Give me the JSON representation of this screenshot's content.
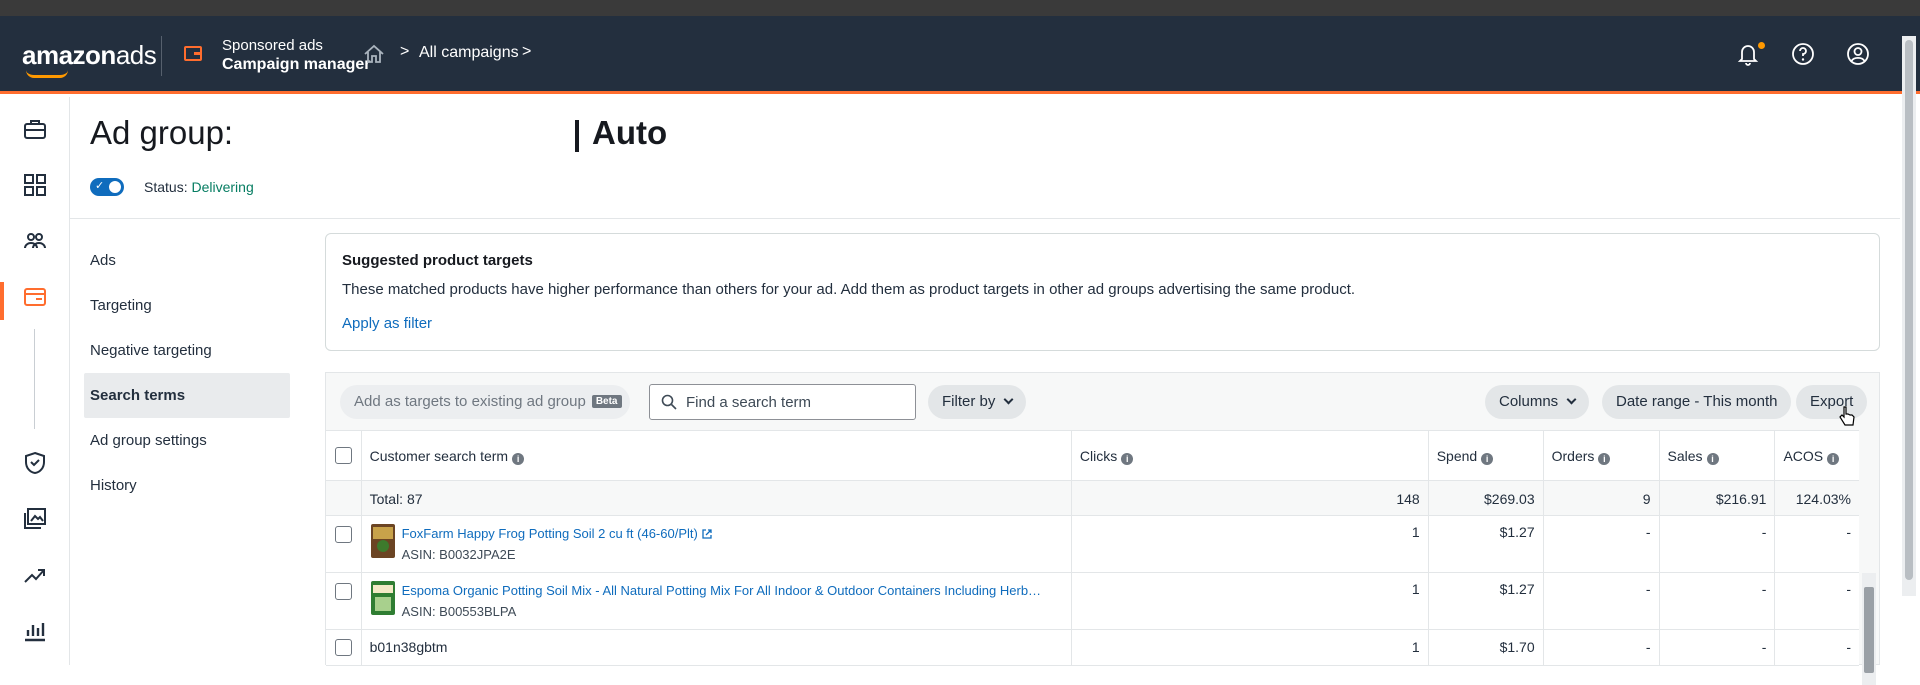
{
  "topnav": {
    "logo_main": "amazon",
    "logo_ads": "ads",
    "app_line1": "Sponsored ads",
    "app_line2": "Campaign manager",
    "breadcrumb_sep1": ">",
    "breadcrumb": "All campaigns",
    "breadcrumb_sep2": ">",
    "icons": [
      "notifications-icon",
      "help-icon",
      "account-icon"
    ]
  },
  "rail": {
    "icons": [
      "briefcase-icon",
      "dashboard-icon",
      "audience-icon",
      "campaigns-icon",
      "shield-icon",
      "media-icon",
      "trend-icon",
      "reports-icon"
    ],
    "accent": "#ff6d2e"
  },
  "header": {
    "title": "Ad group:",
    "title_suffix": "Auto",
    "status_label": "Status:",
    "status_value": "Delivering",
    "status_color": "#067d62"
  },
  "subnav": {
    "items": [
      "Ads",
      "Targeting",
      "Negative targeting",
      "Search terms",
      "Ad group settings",
      "History"
    ],
    "active": "Search terms"
  },
  "suggested": {
    "title": "Suggested product targets",
    "body": "These matched products have higher performance than others for your ad. Add them as product targets in other ad groups advertising the same product.",
    "link": "Apply as filter"
  },
  "toolbar": {
    "add_targets": "Add as targets to existing ad group",
    "beta": "Beta",
    "search_placeholder": "Find a search term",
    "filter_by": "Filter by",
    "columns": "Columns",
    "date_range": "Date range - This month",
    "export": "Export"
  },
  "table": {
    "headers": {
      "term": "Customer search term",
      "clicks": "Clicks",
      "spend": "Spend",
      "orders": "Orders",
      "sales": "Sales",
      "acos": "ACOS"
    },
    "total": {
      "label": "Total: 87",
      "clicks": "148",
      "spend": "$269.03",
      "orders": "9",
      "sales": "$216.91",
      "acos": "124.03%"
    },
    "rows": [
      {
        "name": "FoxFarm Happy Frog Potting Soil 2 cu ft (46-60/Plt)",
        "asin": "ASIN: B0032JPA2E",
        "clicks": "1",
        "spend": "$1.27",
        "orders": "-",
        "sales": "-",
        "acos": "-"
      },
      {
        "name": "Espoma Organic Potting Soil Mix - All Natural Potting Mix For All Indoor & Outdoor Containers Including Herb…",
        "asin": "ASIN: B00553BLPA",
        "clicks": "1",
        "spend": "$1.27",
        "orders": "-",
        "sales": "-",
        "acos": "-"
      },
      {
        "name": "b01n38gbtm",
        "clicks": "1",
        "spend": "$1.70",
        "orders": "-",
        "sales": "-",
        "acos": "-"
      }
    ]
  }
}
